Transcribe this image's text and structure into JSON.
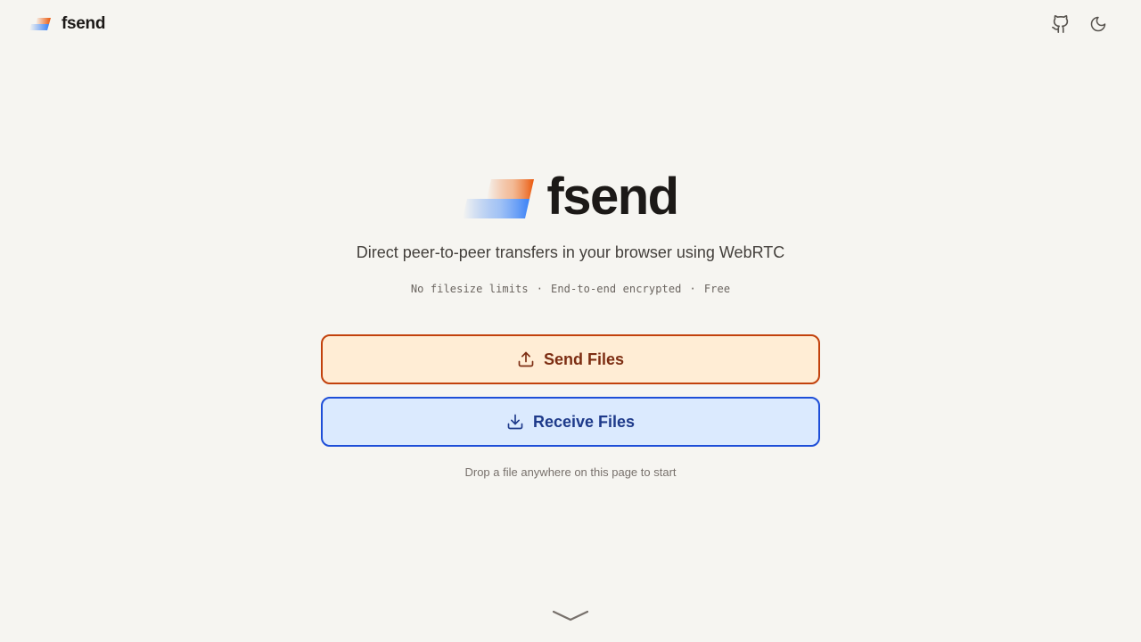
{
  "header": {
    "brand": "fsend",
    "github_icon": "github-icon",
    "theme_icon": "moon-icon"
  },
  "hero": {
    "title": "fsend",
    "tagline": "Direct peer-to-peer transfers in your browser using WebRTC",
    "features": [
      "No filesize limits",
      "End-to-end encrypted",
      "Free"
    ],
    "separator": "·"
  },
  "actions": {
    "send_label": "Send Files",
    "send_icon": "upload-icon",
    "receive_label": "Receive Files",
    "receive_icon": "download-icon"
  },
  "drop_hint": "Drop a file anywhere on this page to start",
  "colors": {
    "background": "#f6f5f1",
    "send_bg": "#ffedd5",
    "send_border": "#c2410c",
    "send_text": "#7c2d12",
    "receive_bg": "#dbeafe",
    "receive_border": "#1d4ed8",
    "receive_text": "#1e3a8a",
    "logo_orange": "#ea580c",
    "logo_blue": "#3b82f6"
  }
}
